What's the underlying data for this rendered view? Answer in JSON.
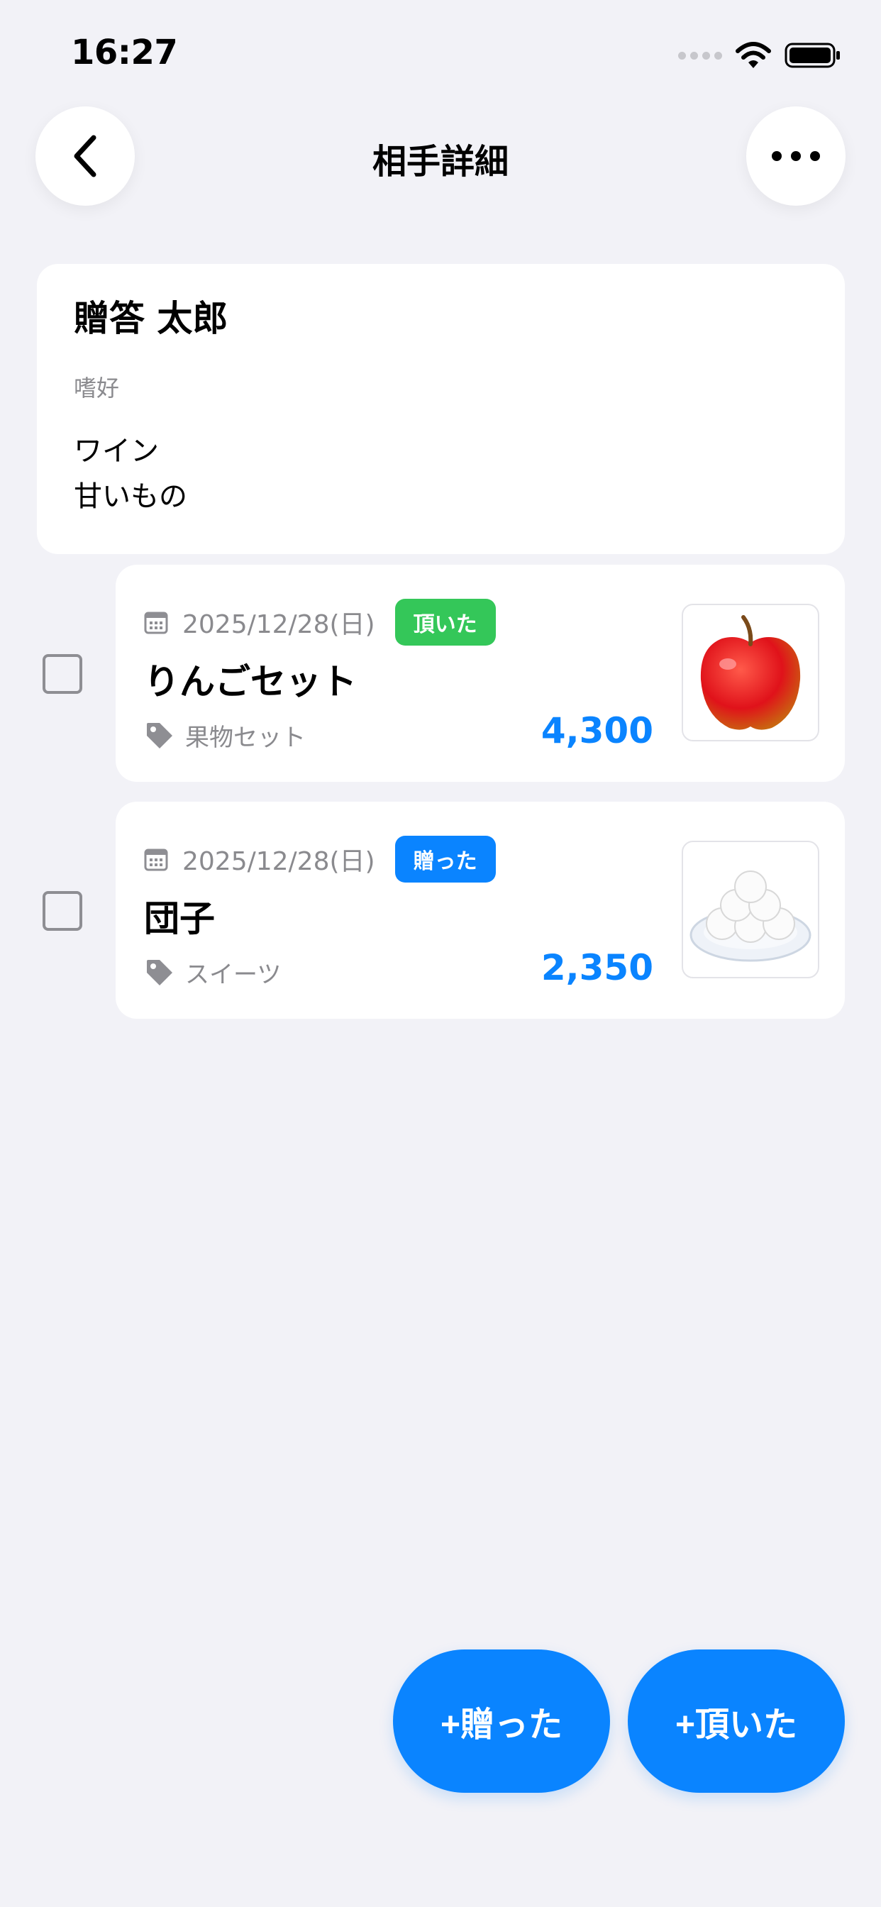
{
  "status_bar": {
    "time": "16:27"
  },
  "nav": {
    "title": "相手詳細",
    "back_icon": "chevron-left-icon",
    "more_icon": "ellipsis-icon"
  },
  "profile": {
    "name": "贈答 太郎",
    "preferences_label": "嗜好",
    "preferences": "ワイン\n甘いもの"
  },
  "records": [
    {
      "date": "2025/12/28(日)",
      "badge": "頂いた",
      "badge_color": "#34c759",
      "title": "りんごセット",
      "category": "果物セット",
      "amount": "4,300",
      "thumbnail_icon": "apple-icon"
    },
    {
      "date": "2025/12/28(日)",
      "badge": "贈った",
      "badge_color": "#0a84ff",
      "title": "団子",
      "category": "スイーツ",
      "amount": "2,350",
      "thumbnail_icon": "dango-icon"
    }
  ],
  "actions": {
    "gave_label": "+贈った",
    "received_label": "+頂いた"
  },
  "colors": {
    "accent": "#0a84ff",
    "background": "#f2f2f7"
  }
}
